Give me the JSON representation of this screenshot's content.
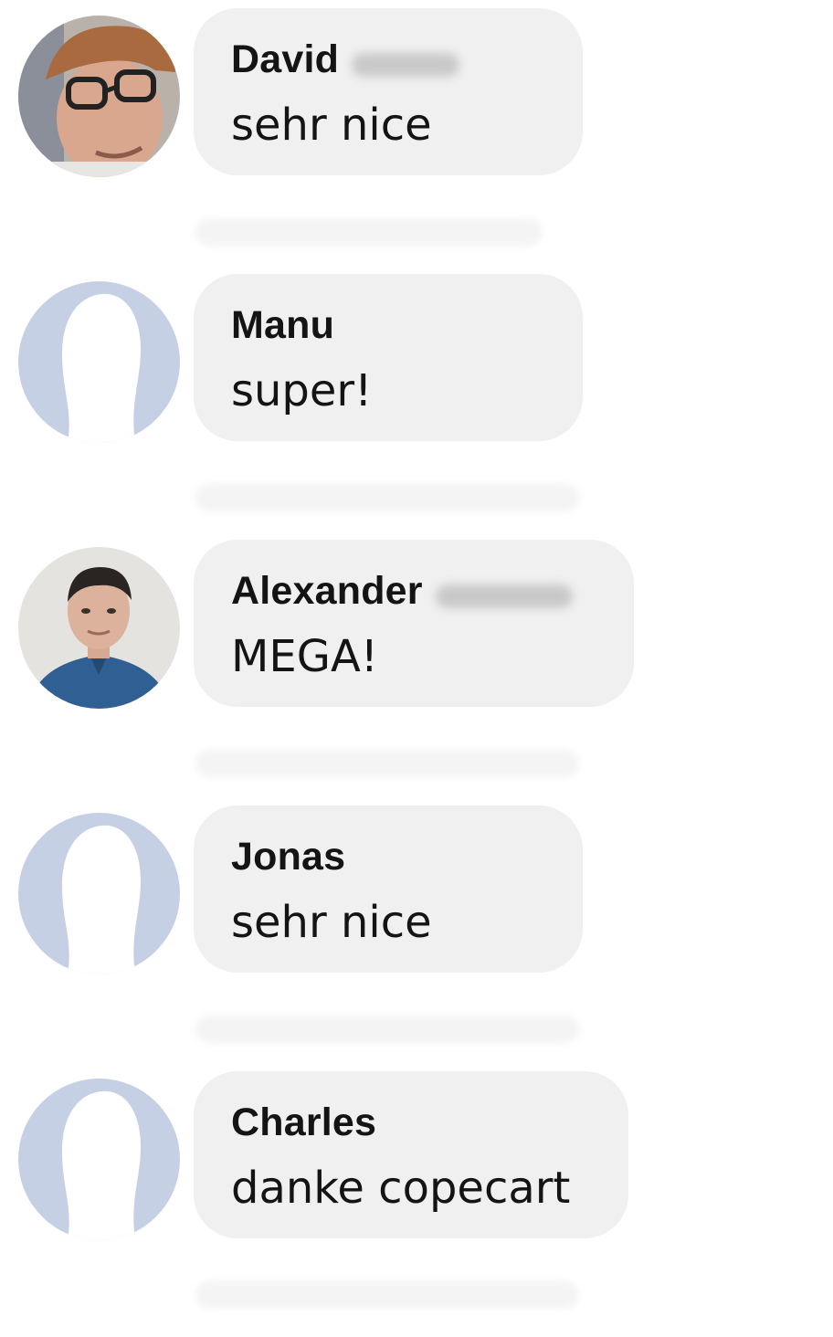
{
  "comments": [
    {
      "first_name": "David",
      "message": "sehr nice",
      "avatar": "photo-man-cap-glasses-icon"
    },
    {
      "first_name": "Manu",
      "message": "super!",
      "avatar": "default-avatar-silhouette-icon"
    },
    {
      "first_name": "Alexander",
      "message": "MEGA!",
      "avatar": "photo-man-blue-shirt-icon"
    },
    {
      "first_name": "Jonas",
      "message": "sehr nice",
      "avatar": "default-avatar-silhouette-icon"
    },
    {
      "first_name": "Charles",
      "message": "danke copecart",
      "avatar": "default-avatar-silhouette-icon"
    }
  ],
  "colors": {
    "bubble_background": "#f0f0f0",
    "default_avatar": "#c5d0e4",
    "text": "#141414"
  }
}
